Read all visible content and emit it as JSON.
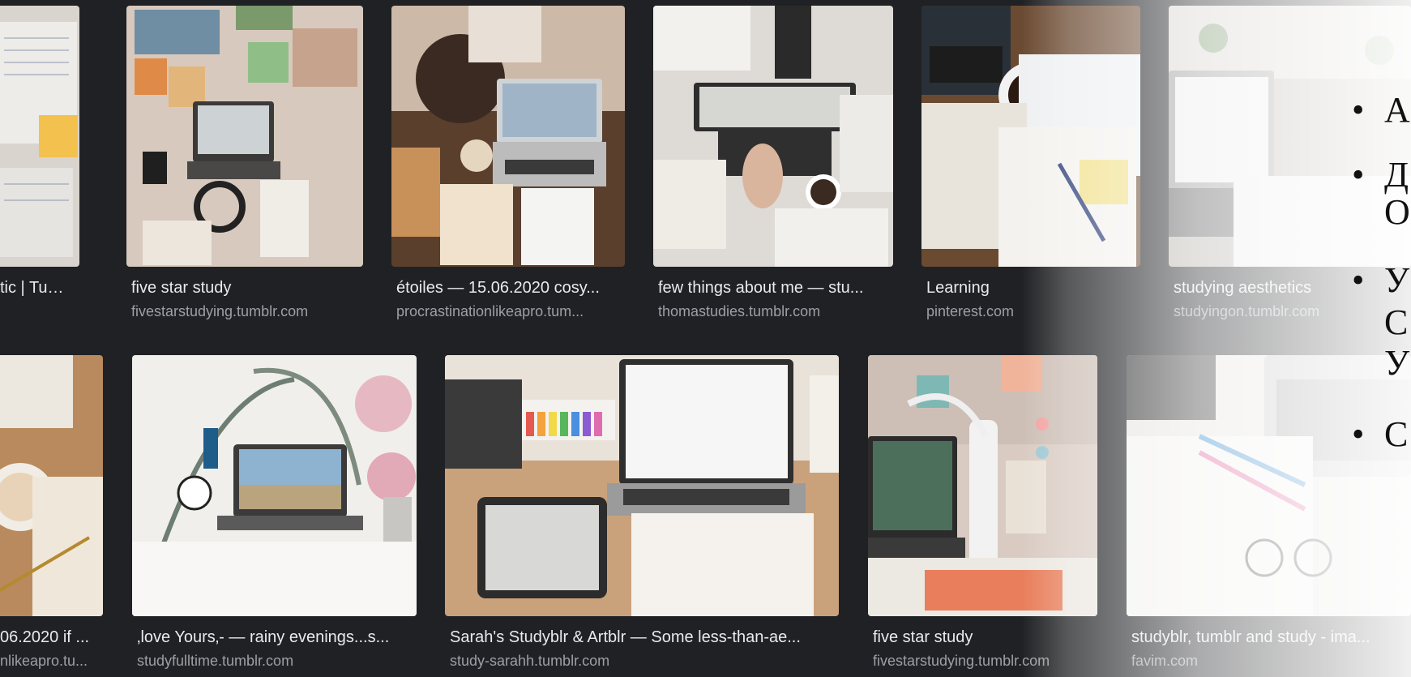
{
  "results": [
    {
      "title": "tic | Tumbl...",
      "source": ""
    },
    {
      "title": "five star study",
      "source": "fivestarstudying.tumblr.com"
    },
    {
      "title": "étoiles — 15.06.2020 cosy...",
      "source": "procrastinationlikeapro.tum..."
    },
    {
      "title": "few things about me — stu...",
      "source": "thomastudies.tumblr.com"
    },
    {
      "title": "Learning",
      "source": "pinterest.com"
    },
    {
      "title": "studying aesthetics",
      "source": "studyingon.tumblr.com"
    },
    {
      "title": "06.2020 if ...",
      "source": "nlikeapro.tu..."
    },
    {
      "title": "‚love Yours‚- — rainy evenings...s...",
      "source": "studyfulltime.tumblr.com"
    },
    {
      "title": "Sarah's Studyblr & Artblr — Some less-than-ae...",
      "source": "study-sarahh.tumblr.com"
    },
    {
      "title": "five star study",
      "source": "fivestarstudying.tumblr.com"
    },
    {
      "title": "studyblr, tumblr and study - ima...",
      "source": "favim.com"
    }
  ],
  "slide": {
    "bullets": [
      "А",
      "Д",
      "О",
      "У",
      "С",
      "У",
      "С"
    ]
  },
  "colors": {
    "background": "#202124",
    "title_text": "#e8eaed",
    "source_text": "#9aa0a6"
  }
}
